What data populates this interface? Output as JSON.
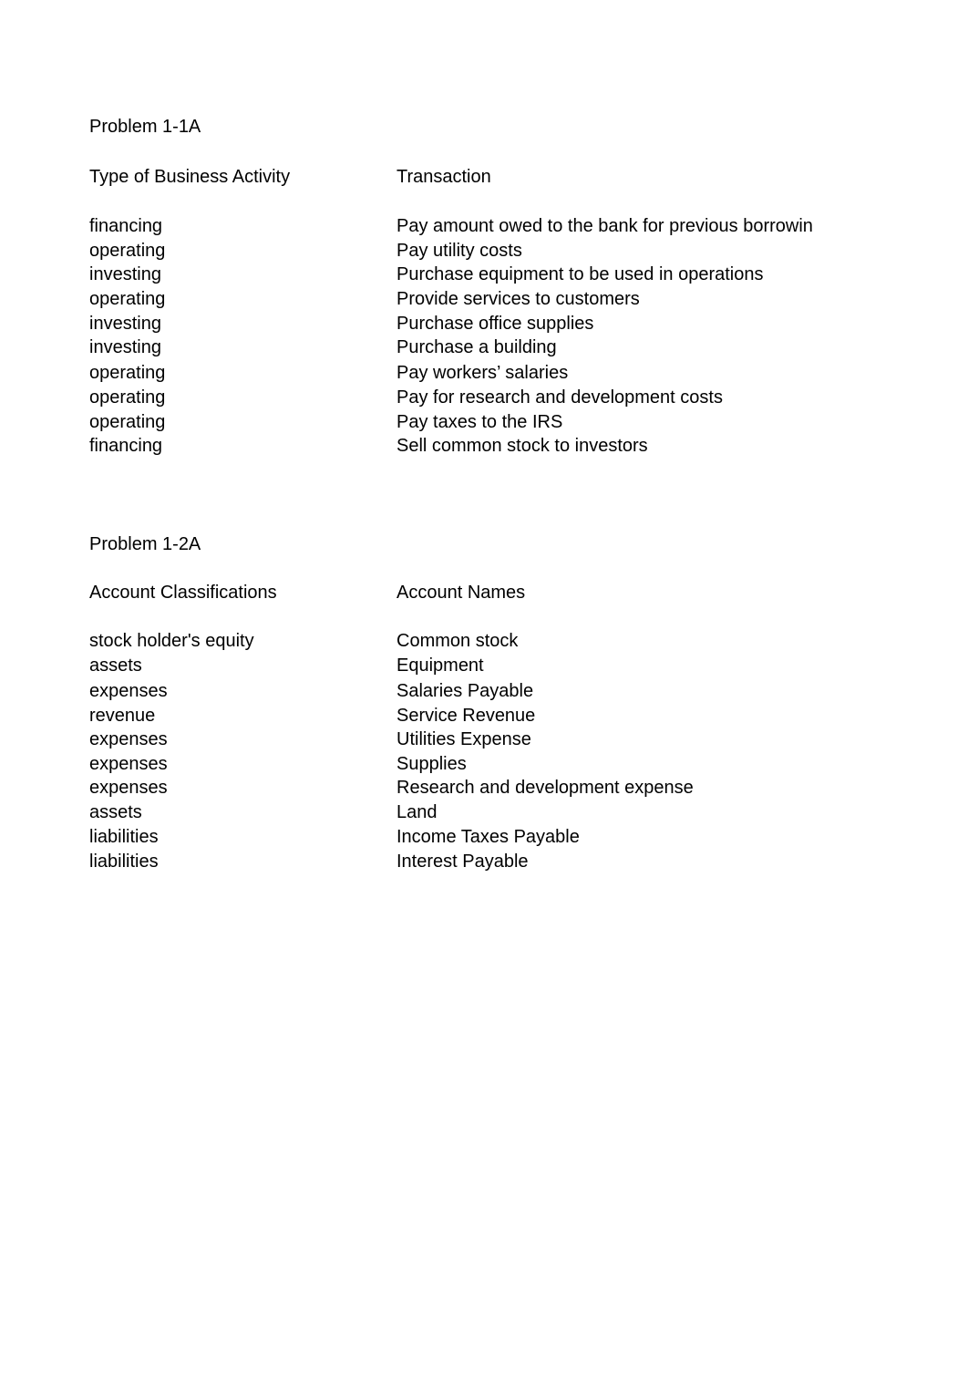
{
  "problem1": {
    "title": "Problem 1-1A",
    "col1_header": "Type of Business Activity",
    "col2_header": "Transaction",
    "rows": [
      {
        "type": "financing",
        "transaction": "Pay amount owed to the bank for previous borrowin"
      },
      {
        "type": "operating",
        "transaction": "Pay utility costs"
      },
      {
        "type": "investing",
        "transaction": "Purchase equipment to be used in operations"
      },
      {
        "type": "operating",
        "transaction": "Provide services to customers"
      },
      {
        "type": "investing",
        "transaction": "Purchase office supplies"
      },
      {
        "type": "investing",
        "transaction": "Purchase a building"
      },
      {
        "type": "operating",
        "transaction": "Pay workers’ salaries"
      },
      {
        "type": "operating",
        "transaction": "Pay for research and development costs"
      },
      {
        "type": "operating",
        "transaction": "Pay taxes to the IRS"
      },
      {
        "type": "financing",
        "transaction": "Sell common stock to investors"
      }
    ]
  },
  "problem2": {
    "title": "Problem 1-2A",
    "col1_header": "Account Classifications",
    "col2_header": "Account Names",
    "rows": [
      {
        "classification": "stock holder's equity",
        "name": "Common stock"
      },
      {
        "classification": "assets",
        "name": "Equipment"
      },
      {
        "classification": "expenses",
        "name": "Salaries Payable"
      },
      {
        "classification": "revenue",
        "name": "Service Revenue"
      },
      {
        "classification": "expenses",
        "name": "Utilities Expense"
      },
      {
        "classification": "expenses",
        "name": "Supplies"
      },
      {
        "classification": "expenses",
        "name": "Research and development expense"
      },
      {
        "classification": "assets",
        "name": "Land"
      },
      {
        "classification": "liabilities",
        "name": "Income Taxes Payable"
      },
      {
        "classification": "liabilities",
        "name": "Interest Payable"
      }
    ]
  }
}
